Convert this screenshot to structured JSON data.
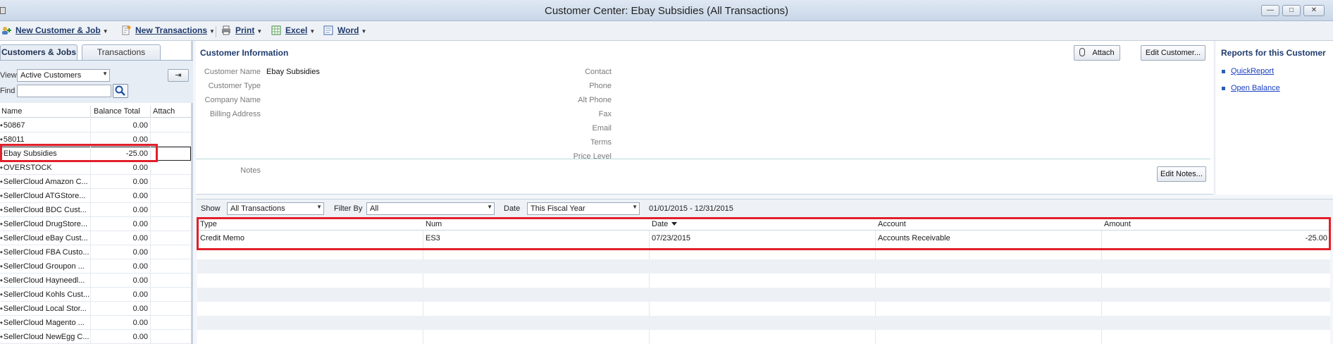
{
  "window": {
    "title": "Customer Center: Ebay Subsidies (All Transactions)"
  },
  "toolbar": {
    "new_customer_job": "New Customer & Job",
    "new_transactions": "New Transactions",
    "print": "Print",
    "excel": "Excel",
    "word": "Word"
  },
  "left": {
    "tabs": [
      "Customers & Jobs",
      "Transactions"
    ],
    "view_label": "View",
    "view_value": "Active Customers",
    "find_label": "Find",
    "find_value": "",
    "collapse_icon": "arrow-collapse-icon",
    "columns": [
      "Name",
      "Balance Total",
      "Attach"
    ],
    "customers": [
      {
        "name": "50867",
        "balance": "0.00"
      },
      {
        "name": "58011",
        "balance": "0.00"
      },
      {
        "name": "Ebay Subsidies",
        "balance": "-25.00"
      },
      {
        "name": "OVERSTOCK",
        "balance": "0.00"
      },
      {
        "name": "SellerCloud Amazon C...",
        "balance": "0.00"
      },
      {
        "name": "SellerCloud ATGStore...",
        "balance": "0.00"
      },
      {
        "name": "SellerCloud BDC Cust...",
        "balance": "0.00"
      },
      {
        "name": "SellerCloud DrugStore...",
        "balance": "0.00"
      },
      {
        "name": "SellerCloud eBay Cust...",
        "balance": "0.00"
      },
      {
        "name": "SellerCloud FBA Custo...",
        "balance": "0.00"
      },
      {
        "name": "SellerCloud Groupon ...",
        "balance": "0.00"
      },
      {
        "name": "SellerCloud Hayneedl...",
        "balance": "0.00"
      },
      {
        "name": "SellerCloud Kohls Cust...",
        "balance": "0.00"
      },
      {
        "name": "SellerCloud Local Stor...",
        "balance": "0.00"
      },
      {
        "name": "SellerCloud Magento ...",
        "balance": "0.00"
      },
      {
        "name": "SellerCloud NewEgg C...",
        "balance": "0.00"
      }
    ]
  },
  "info": {
    "title": "Customer Information",
    "attach_btn": "Attach",
    "edit_customer_btn": "Edit Customer...",
    "edit_notes_btn": "Edit Notes...",
    "labels": {
      "customer_name": "Customer Name",
      "customer_type": "Customer Type",
      "company_name": "Company Name",
      "billing_address": "Billing Address",
      "notes": "Notes",
      "contact": "Contact",
      "phone": "Phone",
      "alt_phone": "Alt Phone",
      "fax": "Fax",
      "email": "Email",
      "terms": "Terms",
      "price_level": "Price Level"
    },
    "values": {
      "customer_name": "Ebay Subsidies"
    }
  },
  "reports": {
    "title": "Reports for this Customer",
    "links": [
      "QuickReport",
      "Open Balance"
    ]
  },
  "filter": {
    "show_label": "Show",
    "show_value": "All Transactions",
    "filter_by_label": "Filter By",
    "filter_by_value": "All",
    "date_label": "Date",
    "date_value": "This Fiscal Year",
    "date_range": "01/01/2015 - 12/31/2015"
  },
  "transactions": {
    "columns": [
      "Type",
      "Num",
      "Date",
      "Account",
      "Amount"
    ],
    "rows": [
      {
        "type": "Credit Memo",
        "num": "ES3",
        "date": "07/23/2015",
        "account": "Accounts Receivable",
        "amount": "-25.00"
      }
    ]
  },
  "colors": {
    "highlight_red": "#e0202a",
    "link_blue": "#1a3fbf",
    "heading_blue": "#1f3b6e"
  }
}
